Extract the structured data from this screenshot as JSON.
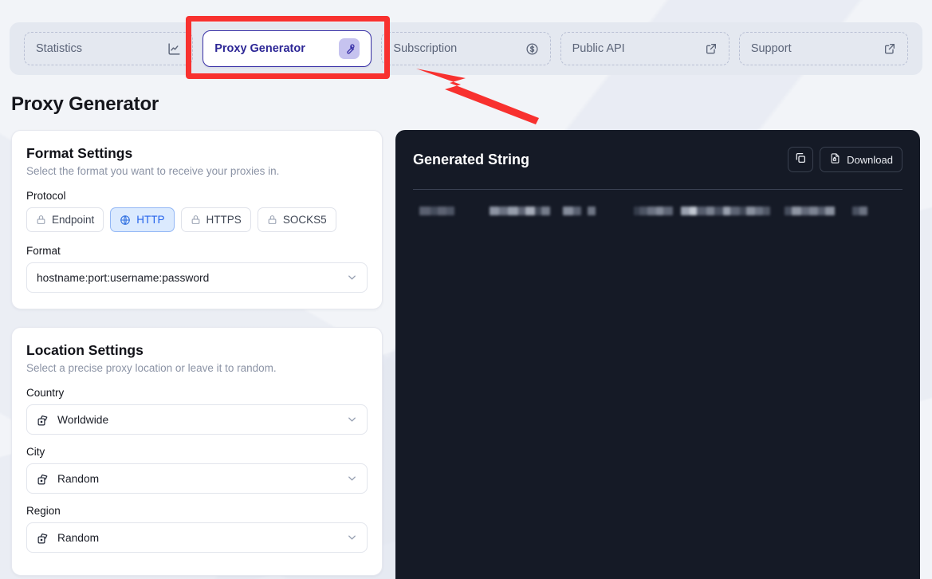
{
  "tabs": [
    {
      "label": "Statistics",
      "icon": "chart-icon",
      "active": false
    },
    {
      "label": "Proxy Generator",
      "icon": "wrench-icon",
      "active": true
    },
    {
      "label": "Subscription",
      "icon": "dollar-circle-icon",
      "active": false
    },
    {
      "label": "Public API",
      "icon": "external-link-icon",
      "active": false
    },
    {
      "label": "Support",
      "icon": "external-link-icon",
      "active": false
    }
  ],
  "page": {
    "title": "Proxy Generator"
  },
  "format_settings": {
    "title": "Format Settings",
    "subtitle": "Select the format you want to receive your proxies in.",
    "protocol_label": "Protocol",
    "protocols": [
      {
        "label": "Endpoint",
        "icon": "lock-icon",
        "selected": false
      },
      {
        "label": "HTTP",
        "icon": "globe-icon",
        "selected": true
      },
      {
        "label": "HTTPS",
        "icon": "lock-icon",
        "selected": false
      },
      {
        "label": "SOCKS5",
        "icon": "lock-icon",
        "selected": false
      }
    ],
    "format_label": "Format",
    "format_value": "hostname:port:username:password"
  },
  "location_settings": {
    "title": "Location Settings",
    "subtitle": "Select a precise proxy location or leave it to random.",
    "fields": [
      {
        "label": "Country",
        "value": "Worldwide",
        "icon": "dice-icon"
      },
      {
        "label": "City",
        "value": "Random",
        "icon": "dice-icon"
      },
      {
        "label": "Region",
        "value": "Random",
        "icon": "dice-icon"
      }
    ]
  },
  "generated": {
    "title": "Generated String",
    "copy_icon": "copy-icon",
    "download_label": "Download",
    "download_icon": "file-lock-icon",
    "content_state": "redacted"
  },
  "annotations": {
    "highlight_color": "#f8312f",
    "highlight_target": "Proxy Generator",
    "arrow_color": "#f8312f"
  },
  "colors": {
    "page_background": "#f2f4f8",
    "tabbar_background": "#e4e8f0",
    "active_tab_border": "#3b33a8",
    "active_tab_text": "#2d2796",
    "protocol_selected_bg": "#dbeafe",
    "protocol_selected_text": "#2563eb",
    "dark_panel": "#151a26"
  }
}
